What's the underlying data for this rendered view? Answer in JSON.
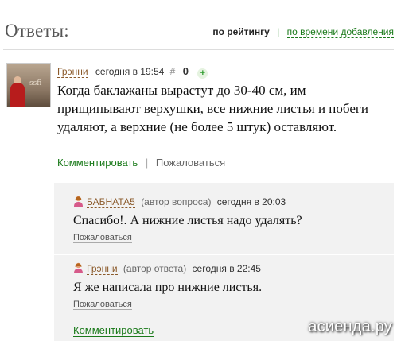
{
  "header": {
    "title": "Ответы:",
    "sort_active": "по рейтингу",
    "sort_separator": "|",
    "sort_link": "по времени добавления"
  },
  "answer": {
    "author": "Грэнни",
    "time": "сегодня в 19:54",
    "hash": "#",
    "score": "0",
    "plus": "+",
    "text": "Когда баклажаны вырастут до 30-40 см, им прищипывают верхушки, все нижние листья и побеги удаляют, а верхние (не более 5 штук) оставляют.",
    "comment_label": "Комментировать",
    "separator": "|",
    "report_label": "Пожаловаться"
  },
  "comments": [
    {
      "author": "БАБНАТА5",
      "role": "(автор вопроса)",
      "time": "сегодня в 20:03",
      "text": "Спасибо!. А нижние листья надо удалять?",
      "report_label": "Пожаловаться"
    },
    {
      "author": "Грэнни",
      "role": "(автор ответа)",
      "time": "сегодня в 22:45",
      "text": "Я же написала про нижние листья.",
      "report_label": "Пожаловаться"
    }
  ],
  "comments_footer": {
    "comment_label": "Комментировать"
  },
  "watermark": "асиенда.ру",
  "colors": {
    "link_green": "#1a7a1a",
    "author_brown": "#8b5a2b",
    "comment_bg": "#f2f2f2"
  },
  "icons": {
    "user_female": "user-female-icon",
    "plus": "plus-icon"
  }
}
